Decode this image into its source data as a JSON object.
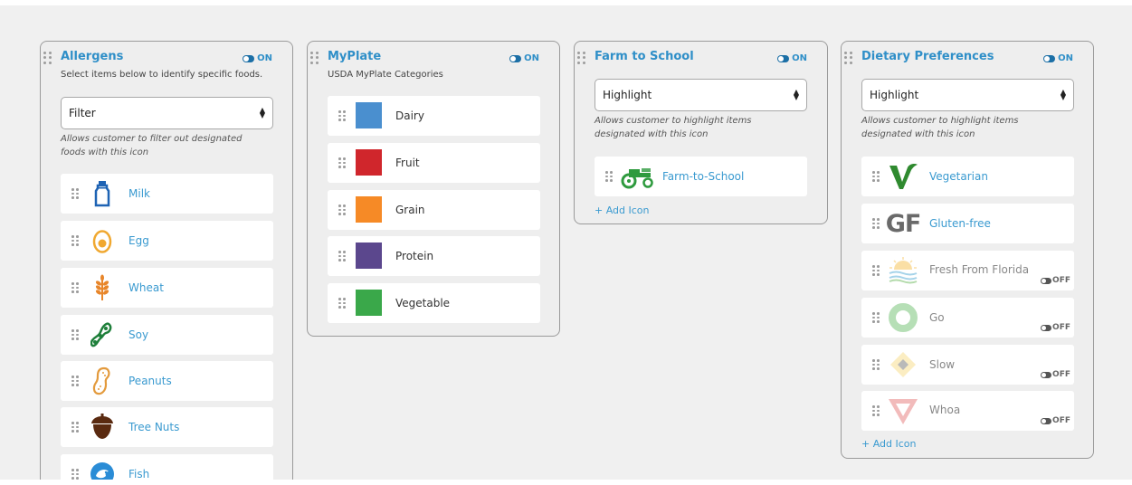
{
  "colors": {
    "accent": "#2f8fc8",
    "link": "#3a9ad0"
  },
  "allergens": {
    "title": "Allergens",
    "toggle": "ON",
    "subtitle": "Select items below to identify specific foods.",
    "select_value": "Filter",
    "help": "Allows customer to filter out designated foods with this icon",
    "items": [
      {
        "label": "Milk",
        "icon": "milk-bottle-icon"
      },
      {
        "label": "Egg",
        "icon": "egg-icon"
      },
      {
        "label": "Wheat",
        "icon": "wheat-icon"
      },
      {
        "label": "Soy",
        "icon": "soybean-icon"
      },
      {
        "label": "Peanuts",
        "icon": "peanut-icon"
      },
      {
        "label": "Tree Nuts",
        "icon": "acorn-icon"
      },
      {
        "label": "Fish",
        "icon": "fish-icon"
      }
    ]
  },
  "myplate": {
    "title": "MyPlate",
    "toggle": "ON",
    "subtitle": "USDA MyPlate Categories",
    "items": [
      {
        "label": "Dairy",
        "color": "#4a8fcf"
      },
      {
        "label": "Fruit",
        "color": "#d0262c"
      },
      {
        "label": "Grain",
        "color": "#f68a26"
      },
      {
        "label": "Protein",
        "color": "#5b478d"
      },
      {
        "label": "Vegetable",
        "color": "#3aa84a"
      }
    ]
  },
  "farm": {
    "title": "Farm to School",
    "toggle": "ON",
    "select_value": "Highlight",
    "help": "Allows customer to highlight items designated with this icon",
    "items": [
      {
        "label": "Farm-to-School",
        "icon": "tractor-icon"
      }
    ],
    "add_icon": "+ Add Icon"
  },
  "dietary": {
    "title": "Dietary Preferences",
    "toggle": "ON",
    "select_value": "Highlight",
    "help": "Allows customer to highlight items designated with this icon",
    "items": [
      {
        "label": "Vegetarian",
        "icon": "vegetarian-v-icon",
        "toggle": ""
      },
      {
        "label": "Gluten-free",
        "icon": "gluten-free-gf-icon",
        "toggle": ""
      },
      {
        "label": "Fresh From Florida",
        "icon": "sunrise-icon",
        "toggle": "OFF"
      },
      {
        "label": "Go",
        "icon": "go-circle-icon",
        "toggle": "OFF"
      },
      {
        "label": "Slow",
        "icon": "slow-diamond-icon",
        "toggle": "OFF"
      },
      {
        "label": "Whoa",
        "icon": "whoa-triangle-icon",
        "toggle": "OFF"
      }
    ],
    "add_icon": "+ Add Icon"
  }
}
